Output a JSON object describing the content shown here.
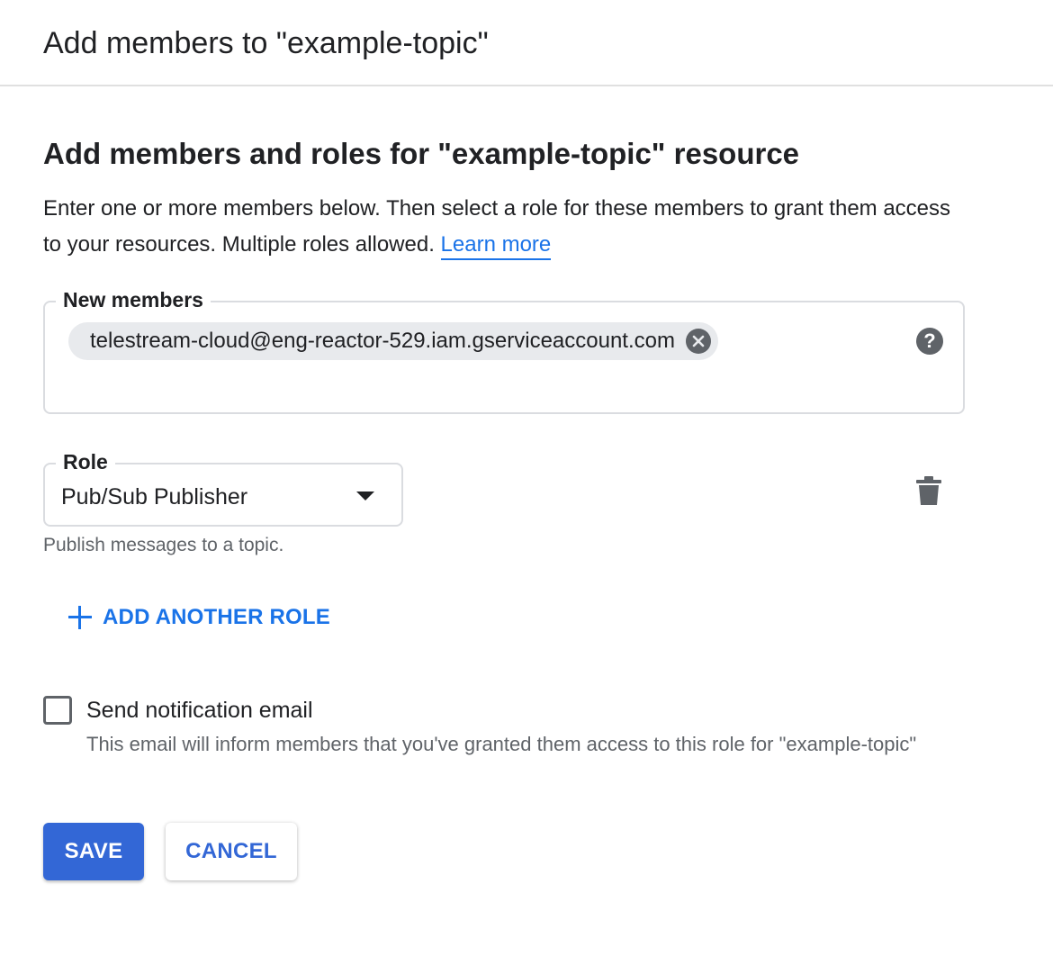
{
  "dialog": {
    "title": "Add members to \"example-topic\""
  },
  "section": {
    "heading": "Add members and roles for \"example-topic\" resource",
    "description": "Enter one or more members below. Then select a role for these members to grant them access to your resources. Multiple roles allowed.",
    "learn_more": "Learn more"
  },
  "members": {
    "legend": "New members",
    "chips": [
      {
        "label": "telestream-cloud@eng-reactor-529.iam.gserviceaccount.com"
      }
    ],
    "help_icon": "help-circle-icon",
    "remove_icon": "close-circle-icon"
  },
  "role": {
    "legend": "Role",
    "selected": "Pub/Sub Publisher",
    "help_text": "Publish messages to a topic.",
    "dropdown_icon": "caret-down-icon",
    "delete_icon": "trash-icon"
  },
  "add_role": {
    "label": "ADD ANOTHER ROLE",
    "icon": "plus-icon"
  },
  "notification": {
    "label": "Send notification email",
    "checked": false,
    "help_text": "This email will inform members that you've granted them access to this role for \"example-topic\""
  },
  "actions": {
    "save_label": "SAVE",
    "cancel_label": "CANCEL"
  },
  "colors": {
    "accent": "#1a73e8",
    "primary_button": "#3367d6",
    "chip_background": "#e8eaed",
    "border": "#dadce0",
    "secondary_text": "#5f6368"
  }
}
